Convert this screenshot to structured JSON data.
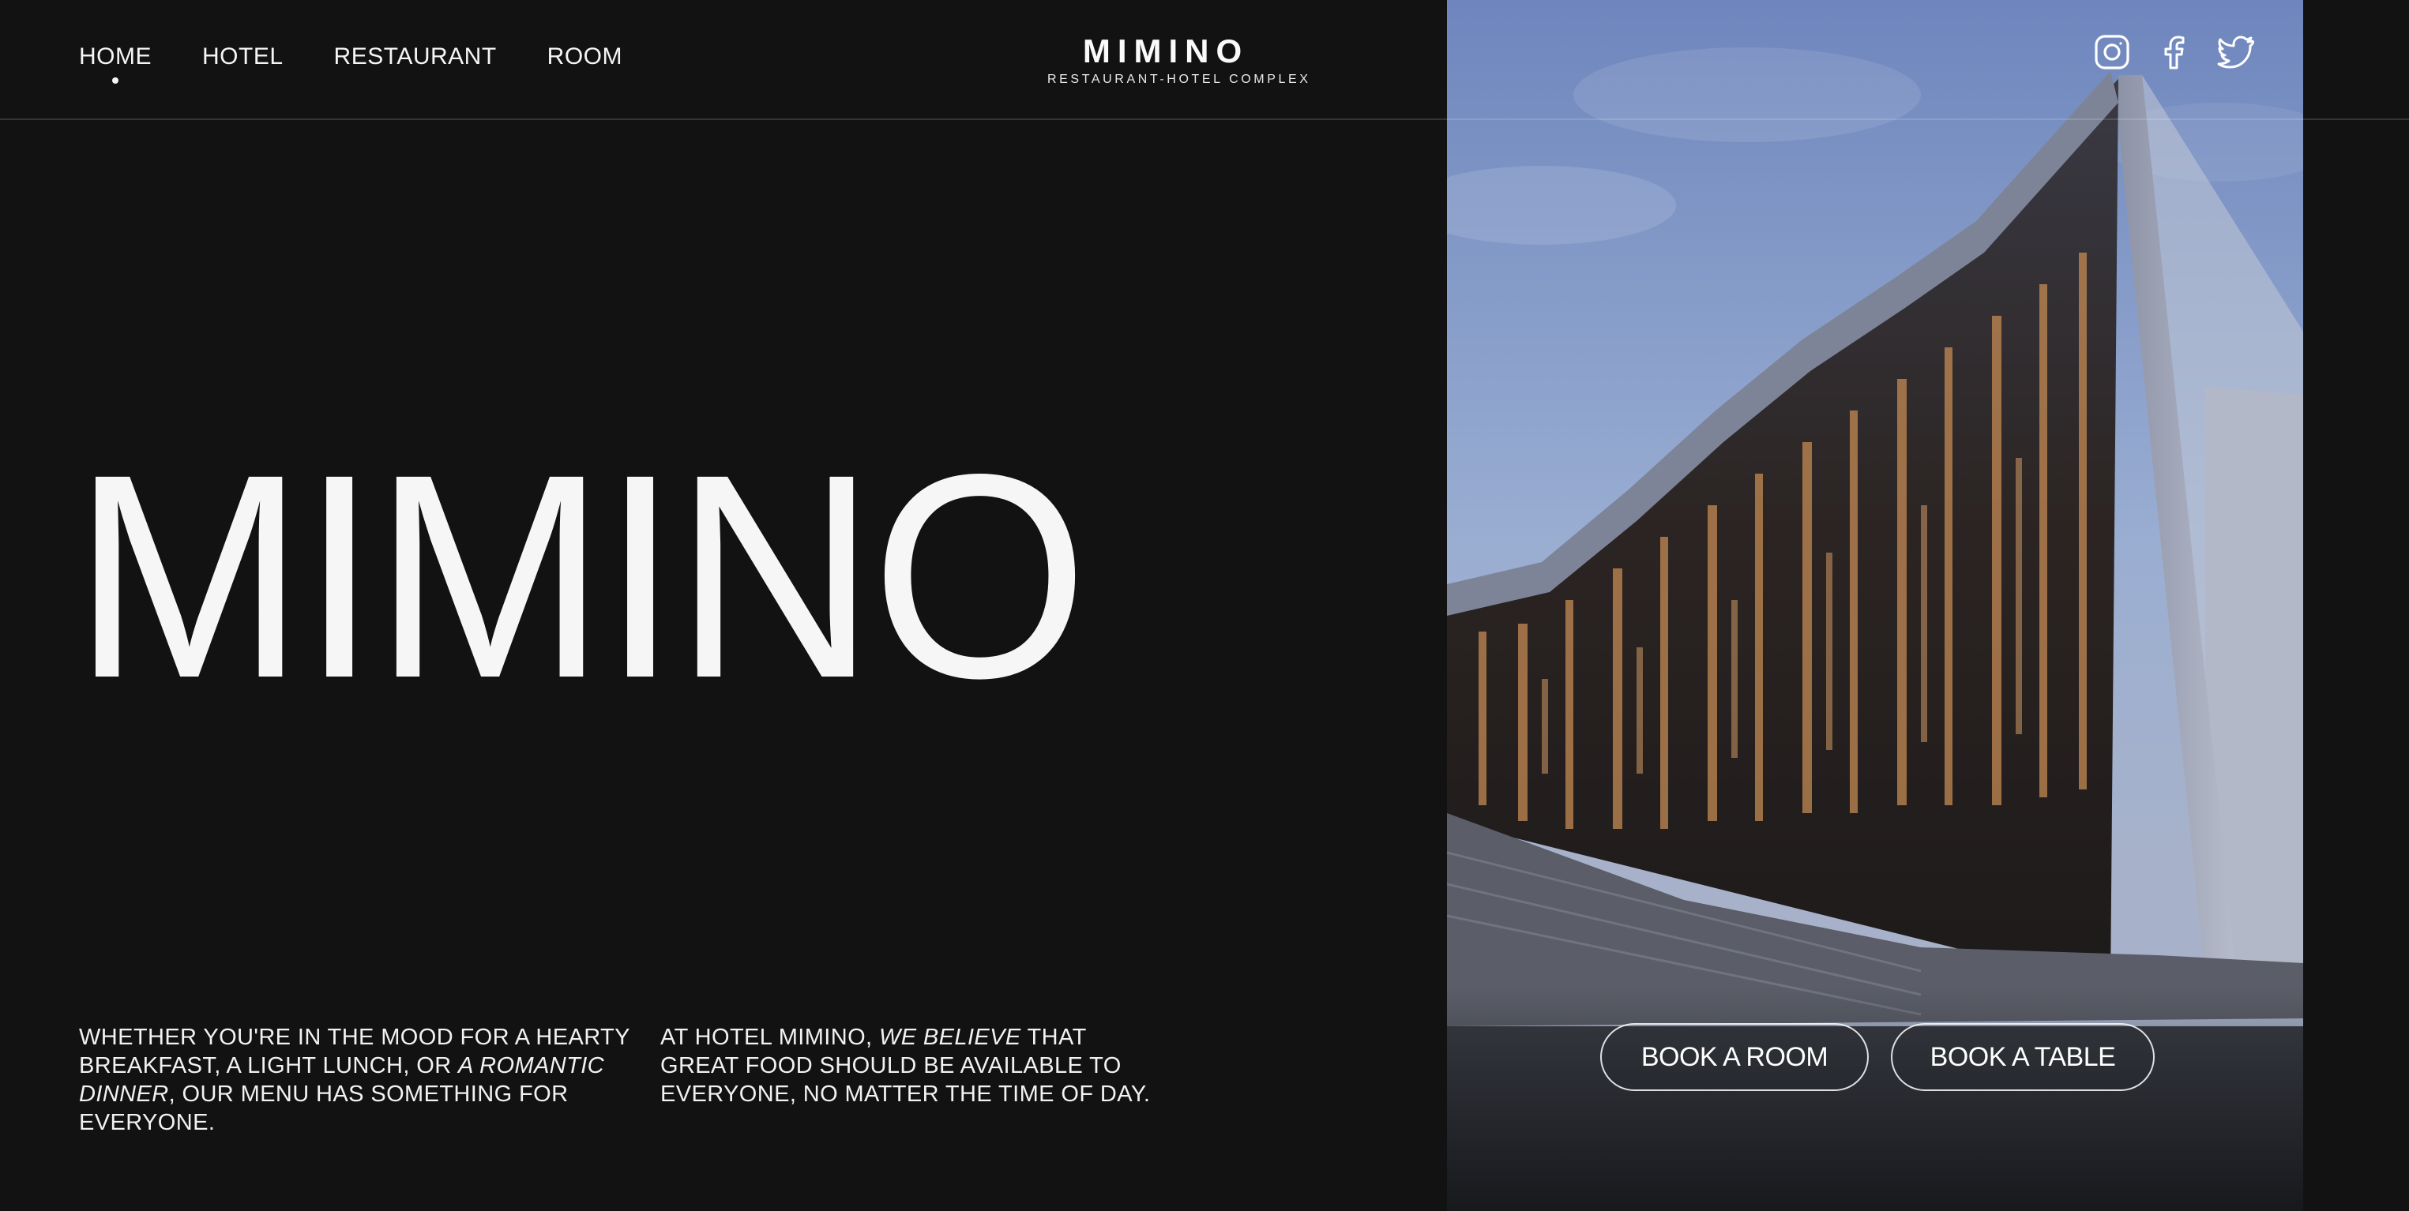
{
  "nav": {
    "items": [
      {
        "label": "HOME",
        "active": true
      },
      {
        "label": "HOTEL"
      },
      {
        "label": "RESTAURANT"
      },
      {
        "label": "ROOM"
      }
    ]
  },
  "logo": {
    "title": "MIMINO",
    "subtitle": "RESTAURANT-HOTEL COMPLEX"
  },
  "socials": {
    "icons": [
      "instagram-icon",
      "facebook-icon",
      "twitter-icon"
    ]
  },
  "hero": {
    "title": "MIMINO"
  },
  "copy": {
    "left": {
      "part1": "WHETHER YOU'RE IN THE MOOD FOR A HEARTY BREAKFAST, A LIGHT LUNCH, OR ",
      "emph": "A ROMANTIC DINNER",
      "part2": ", OUR MENU HAS SOMETHING FOR EVERYONE."
    },
    "right": {
      "part1": "AT HOTEL MIMINO, ",
      "emph": "WE BELIEVE",
      "part2": " THAT GREAT FOOD SHOULD BE AVAILABLE TO EVERYONE, NO MATTER THE TIME OF DAY."
    }
  },
  "buttons": {
    "book_room": "BOOK A ROOM",
    "book_table": "BOOK A TABLE"
  },
  "colors": {
    "background": "#121212",
    "text": "#f3f3f3",
    "sky": "#8da3cb"
  }
}
